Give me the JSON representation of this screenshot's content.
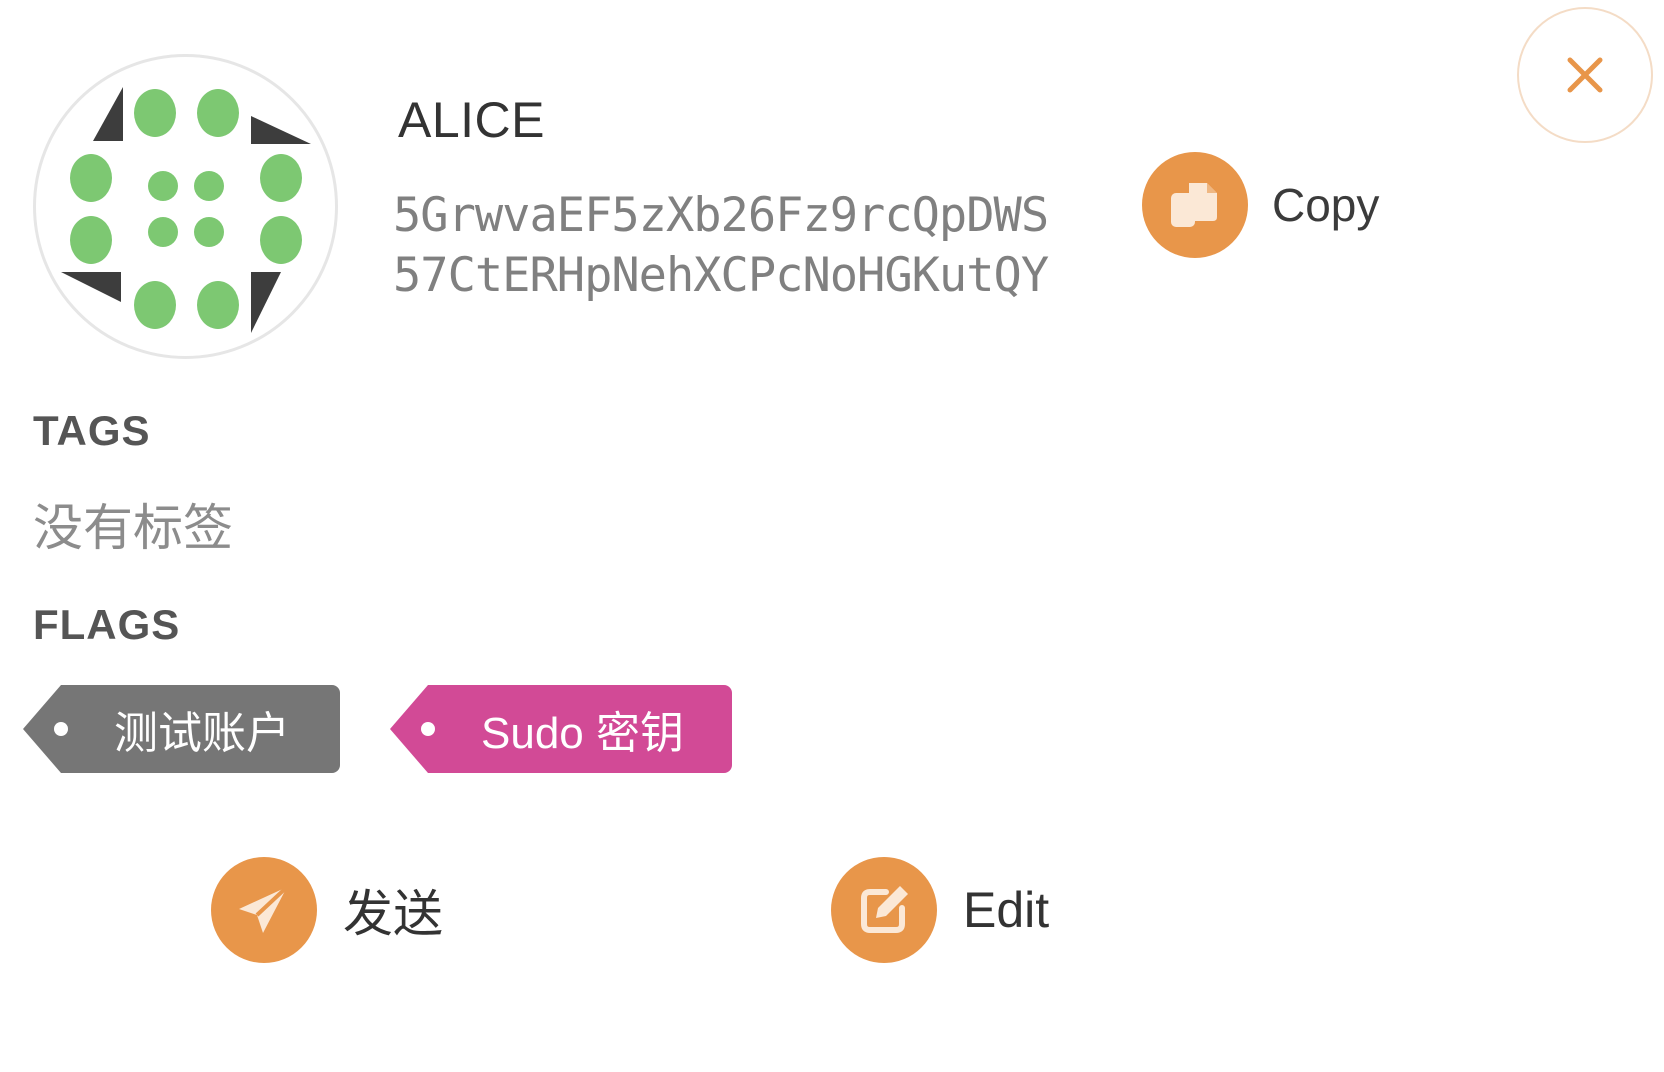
{
  "account": {
    "name": "ALICE",
    "address_line_1": "5GrwvaEF5zXb26Fz9rcQpDWS",
    "address_line_2": "57CtERHpNehXCPcNoHGKutQY"
  },
  "buttons": {
    "copy_label": "Copy",
    "send_label": "发送",
    "edit_label": "Edit",
    "close_icon": "close-icon",
    "copy_icon": "copy-icon",
    "send_icon": "send-icon",
    "edit_icon": "edit-icon"
  },
  "tags": {
    "heading": "TAGS",
    "empty_text": "没有标签"
  },
  "flags": {
    "heading": "FLAGS",
    "items": [
      {
        "label": "测试账户",
        "color": "#767676"
      },
      {
        "label": "Sudo 密钥",
        "color": "#d24a96"
      }
    ]
  },
  "colors": {
    "accent": "#e8964a",
    "identicon_dot": "#7dc872",
    "identicon_triangle": "#3d3d3d"
  }
}
